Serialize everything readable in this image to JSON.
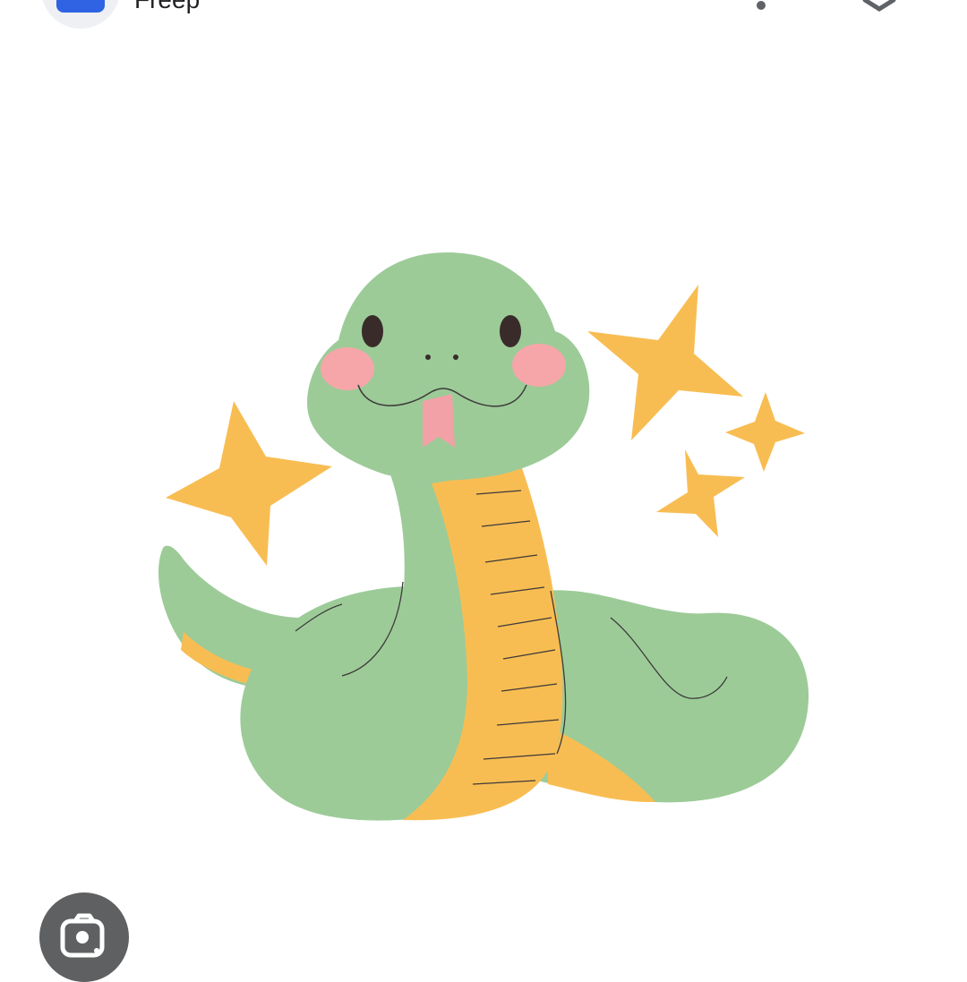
{
  "header": {
    "site_name": "Freep",
    "favicon_icon": "site-favicon-icon",
    "more_icon": "more-vert-icon",
    "close_icon": "close-icon"
  },
  "image": {
    "subject": "cartoon-snake-illustration",
    "colors": {
      "snake_body": "#9ccb98",
      "snake_belly": "#f8bd52",
      "stars": "#f8bd52",
      "cheeks": "#f6a6a8",
      "tongue": "#f2a1a6",
      "eyes": "#3a2b2b"
    }
  },
  "lens": {
    "icon": "google-lens-icon",
    "background": "#5f6062"
  }
}
